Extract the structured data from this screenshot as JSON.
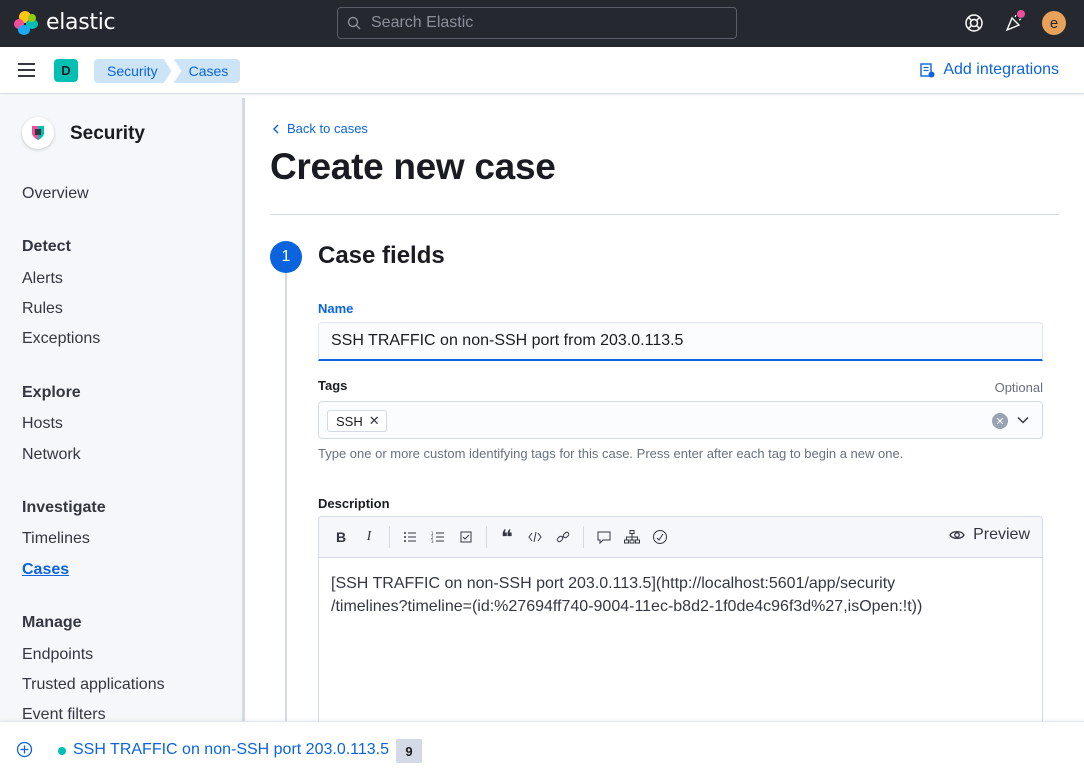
{
  "header": {
    "brand": "elastic",
    "search_placeholder": "Search Elastic",
    "user_initial": "e"
  },
  "subbar": {
    "space_initial": "D",
    "breadcrumbs": [
      "Security",
      "Cases"
    ],
    "add_integrations": "Add integrations"
  },
  "sidebar": {
    "title": "Security",
    "overview": "Overview",
    "sections": [
      {
        "heading": "Detect",
        "items": [
          "Alerts",
          "Rules",
          "Exceptions"
        ]
      },
      {
        "heading": "Explore",
        "items": [
          "Hosts",
          "Network"
        ]
      },
      {
        "heading": "Investigate",
        "items": [
          "Timelines",
          "Cases"
        ]
      },
      {
        "heading": "Manage",
        "items": [
          "Endpoints",
          "Trusted applications",
          "Event filters"
        ]
      }
    ],
    "active_item": "Cases"
  },
  "main": {
    "back_link": "Back to cases",
    "title": "Create new case",
    "step_number": "1",
    "step_title": "Case fields",
    "name_label": "Name",
    "name_value": "SSH TRAFFIC on non-SSH port from 203.0.113.5",
    "tags_label": "Tags",
    "tags_optional": "Optional",
    "tags": [
      "SSH"
    ],
    "tags_help": "Type one or more custom identifying tags for this case. Press enter after each tag to begin a new one.",
    "description_label": "Description",
    "preview_label": "Preview",
    "description_value": "[SSH TRAFFIC on non-SSH port 203.0.113.5](http://localhost:5601/app/security\n/timelines?timeline=(id:%27694ff740-9004-11ec-b8d2-1f0de4c96f3d%27,isOpen:!t))"
  },
  "timeline_bar": {
    "title": "SSH TRAFFIC on non-SSH port 203.0.113.5",
    "count": "9"
  },
  "colors": {
    "accent": "#0b64dd",
    "header_bg": "#25282f",
    "space_badge": "#00bfb3"
  }
}
